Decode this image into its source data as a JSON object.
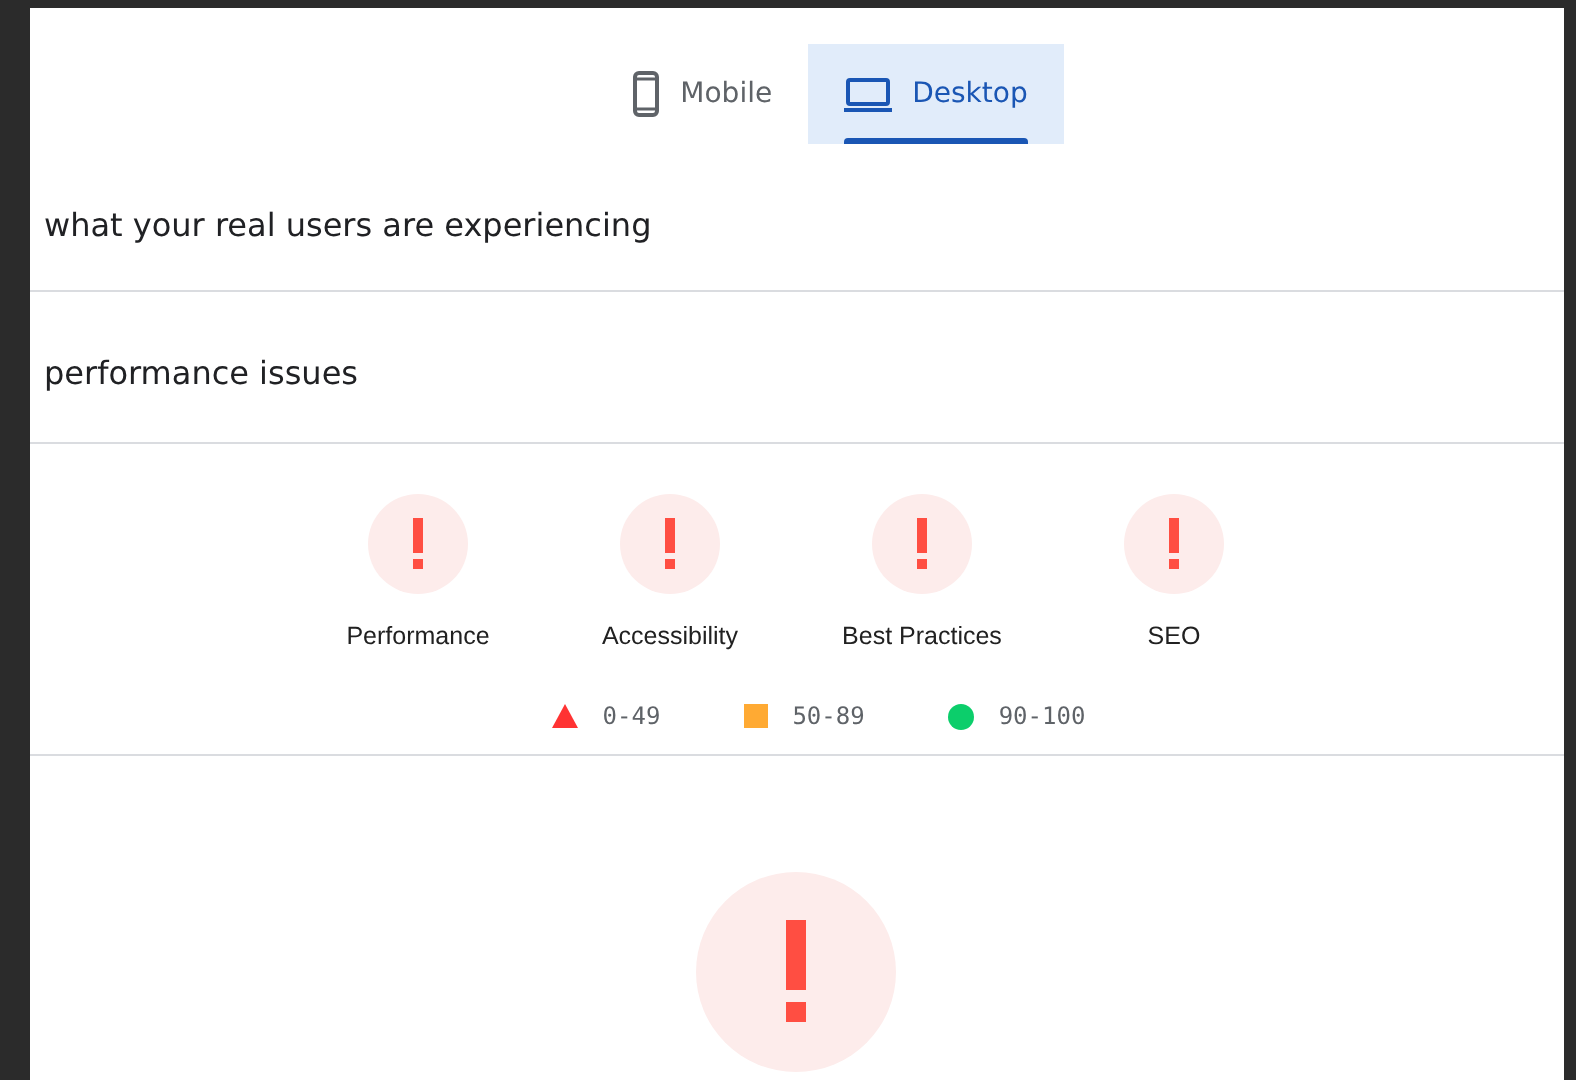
{
  "tabs": [
    {
      "label": "Mobile",
      "selected": false
    },
    {
      "label": "Desktop",
      "selected": true
    }
  ],
  "sections": [
    {
      "heading": "what your real users are experiencing"
    },
    {
      "heading": "performance issues"
    }
  ],
  "categories": [
    {
      "label": "Performance",
      "failing": true
    },
    {
      "label": "Accessibility",
      "failing": true
    },
    {
      "label": "Best Practices",
      "failing": true
    },
    {
      "label": "SEO",
      "failing": true
    }
  ],
  "legend": [
    {
      "kind": "triangle",
      "range": "0-49",
      "color": "#ff3333"
    },
    {
      "kind": "square",
      "range": "50-89",
      "color": "#ffaa33"
    },
    {
      "kind": "circle",
      "range": "90-100",
      "color": "#0cce6b"
    }
  ],
  "main_gauge": {
    "failing": true
  }
}
